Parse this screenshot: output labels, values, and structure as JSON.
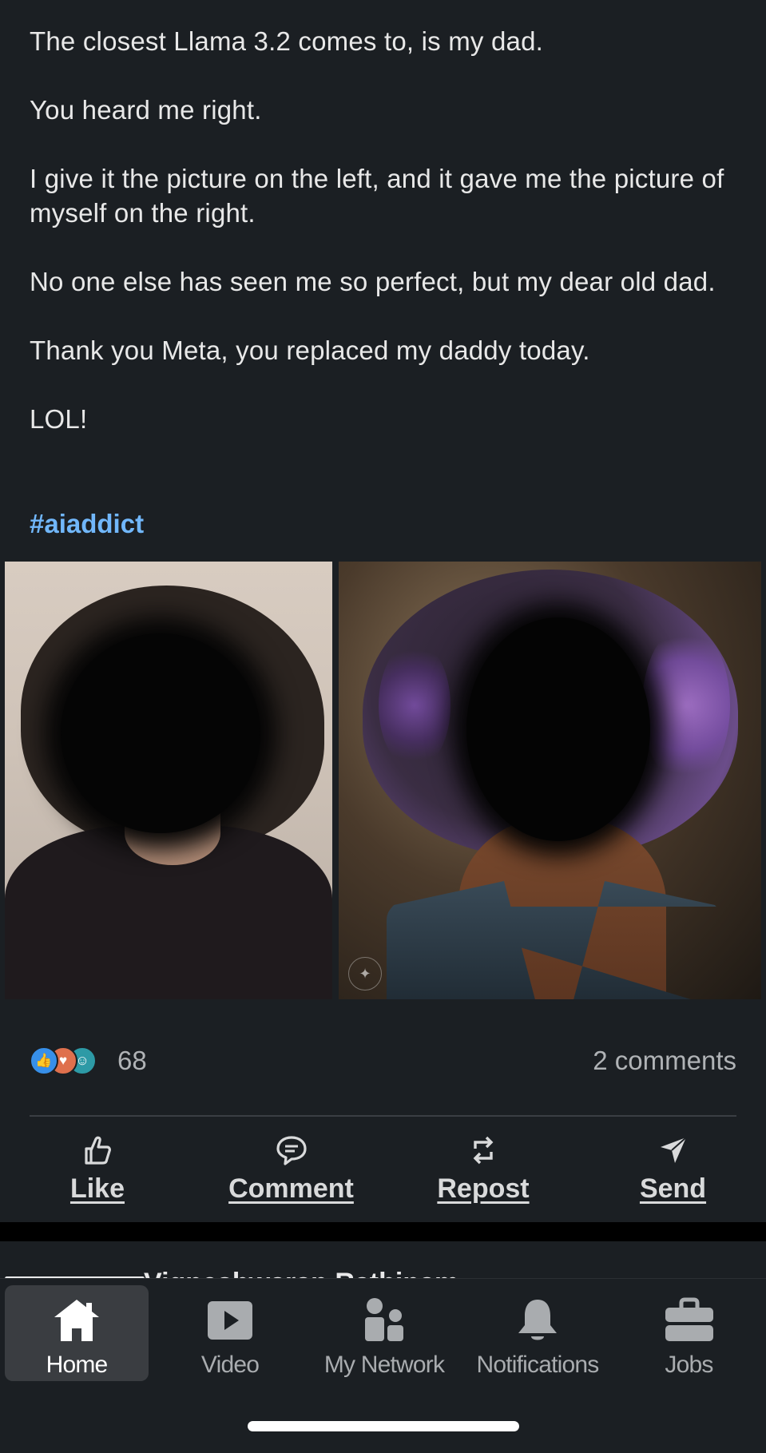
{
  "post": {
    "paragraphs": [
      "The closest Llama 3.2 comes to, is my dad.",
      "You heard me right.",
      "I give it the picture on the left, and it gave me the picture of myself on the right.",
      "No one else has seen me so perfect, but my dear old dad.",
      "Thank you Meta, you replaced my daddy today.",
      "LOL!"
    ],
    "hashtag": "#aiaddict",
    "images": [
      {
        "name": "original-photo"
      },
      {
        "name": "ai-generated-photo"
      }
    ]
  },
  "social": {
    "reactions": [
      "like-reaction-icon",
      "love-reaction-icon",
      "funny-reaction-icon"
    ],
    "reaction_count": "68",
    "comments_count": "2 comments"
  },
  "actions": {
    "like_label": "Like",
    "comment_label": "Comment",
    "repost_label": "Repost",
    "send_label": "Send"
  },
  "next_post": {
    "author_partial": "Vigneshwaran Rathinam"
  },
  "tabbar": {
    "home_label": "Home",
    "video_label": "Video",
    "network_label": "My Network",
    "notifications_label": "Notifications",
    "jobs_label": "Jobs",
    "active": "Home"
  },
  "colors": {
    "background": "#1b1f23",
    "hashtag": "#71b7fb",
    "text": "#e8e8e8",
    "muted": "#b0b3b6"
  }
}
